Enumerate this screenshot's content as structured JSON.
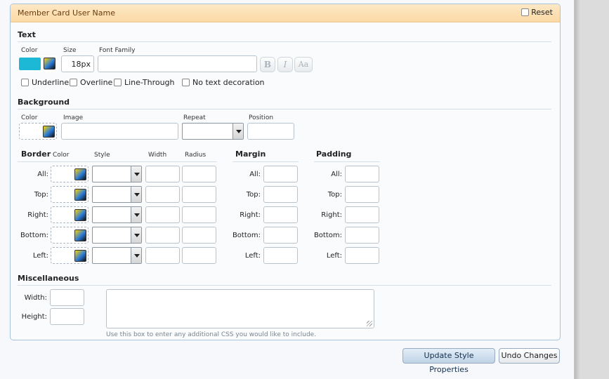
{
  "panel": {
    "title": "Member Card User Name",
    "reset_label": "Reset"
  },
  "text": {
    "title": "Text",
    "color_label": "Color",
    "color_value": "#1cb8d6",
    "size_label": "Size",
    "size_value": "18px",
    "font_family_label": "Font Family",
    "bold_glyph": "B",
    "italic_glyph": "I",
    "case_glyph": "Aa",
    "decorations": [
      "Underline",
      "Overline",
      "Line-Through",
      "No text decoration"
    ]
  },
  "background": {
    "title": "Background",
    "color_label": "Color",
    "image_label": "Image",
    "repeat_label": "Repeat",
    "position_label": "Position"
  },
  "border": {
    "title": "Border",
    "color_label": "Color",
    "style_label": "Style",
    "width_label": "Width",
    "radius_label": "Radius",
    "rows": [
      "All:",
      "Top:",
      "Right:",
      "Bottom:",
      "Left:"
    ]
  },
  "margin": {
    "title": "Margin",
    "rows": [
      "All:",
      "Top:",
      "Right:",
      "Bottom:",
      "Left:"
    ]
  },
  "padding": {
    "title": "Padding",
    "rows": [
      "All:",
      "Top:",
      "Right:",
      "Bottom:",
      "Left:"
    ]
  },
  "misc": {
    "title": "Miscellaneous",
    "width_label": "Width:",
    "height_label": "Height:",
    "hint": "Use this box to enter any additional CSS you would like to include."
  },
  "actions": {
    "update_label": "Update Style Properties",
    "undo_label": "Undo Changes"
  }
}
